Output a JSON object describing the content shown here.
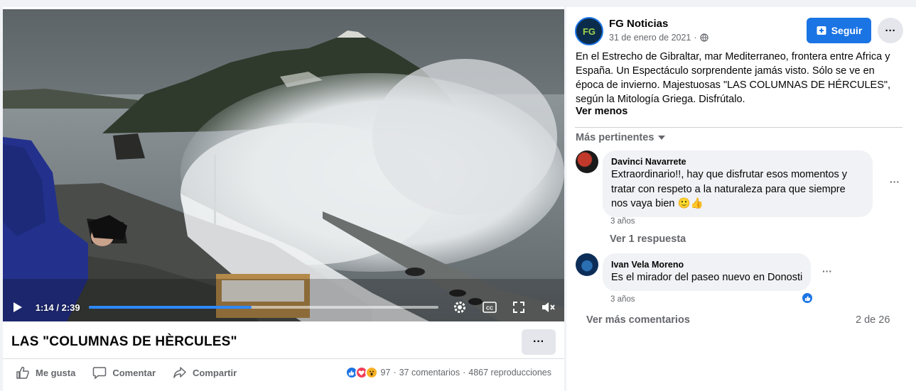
{
  "video": {
    "current_time": "1:14",
    "duration": "2:39",
    "time_display": "1:14 / 2:39",
    "progress": 0.465
  },
  "post": {
    "title": "LAS \"COLUMNAS DE HÈRCULES\"",
    "author": "FG Noticias",
    "date": "31 de enero de 2021",
    "privacy_icon": "globe-icon",
    "text": "En el Estrecho de Gibraltar, mar Mediterraneo, frontera entre Africa y España. Un Espectáculo sorprendente jamás visto. Sólo se ve en época de invierno. Majestuosas \"LAS COLUMNAS DE HÉRCULES\", según la Mitología Griega. Disfrútalo.",
    "see_less": "Ver menos",
    "follow_label": "Seguir"
  },
  "actions": {
    "like": "Me gusta",
    "comment": "Comentar",
    "share": "Compartir"
  },
  "stats": {
    "reactions": "97",
    "comments": "37 comentarios",
    "views": "4867 reproducciones"
  },
  "comments_section": {
    "sort_label": "Más pertinentes",
    "items": [
      {
        "name": "Davinci Navarrete",
        "text": "Extraordinario!!, hay que disfrutar esos momentos y tratar con respeto a la naturaleza para que siempre nos vaya bien 🙂👍",
        "time": "3 años"
      },
      {
        "name": "Ivan Vela Moreno",
        "text": "Es el mirador del paseo nuevo en Donosti",
        "time": "3 años"
      }
    ],
    "reply_link": "Ver 1 respuesta",
    "more_comments": "Ver más comentarios",
    "pager": "2 de 26"
  },
  "colors": {
    "accent": "#1b74e4",
    "progress": "#2d88ff",
    "background": "#f0f2f5"
  }
}
